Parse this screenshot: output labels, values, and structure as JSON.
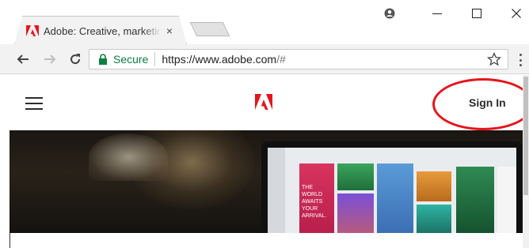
{
  "browser": {
    "tab_title": "Adobe: Creative, marketing",
    "tab_close": "×",
    "secure_label": "Secure",
    "url_host": "https://www.adobe.com",
    "url_path": "/#"
  },
  "site": {
    "signin_label": "Sign In"
  },
  "hero": {
    "card_text": "THE WORLD AWAITS YOUR ARRIVAL."
  },
  "colors": {
    "adobe_red": "#e8141a",
    "secure_green": "#0b8043",
    "annotation": "#e8141a"
  },
  "icons": [
    "adobe-favicon-icon",
    "close-icon",
    "profile-icon",
    "minimize-icon",
    "maximize-icon",
    "window-close-icon",
    "back-icon",
    "forward-icon",
    "reload-icon",
    "lock-icon",
    "star-icon",
    "menu-icon",
    "hamburger-icon",
    "adobe-logo-icon"
  ]
}
